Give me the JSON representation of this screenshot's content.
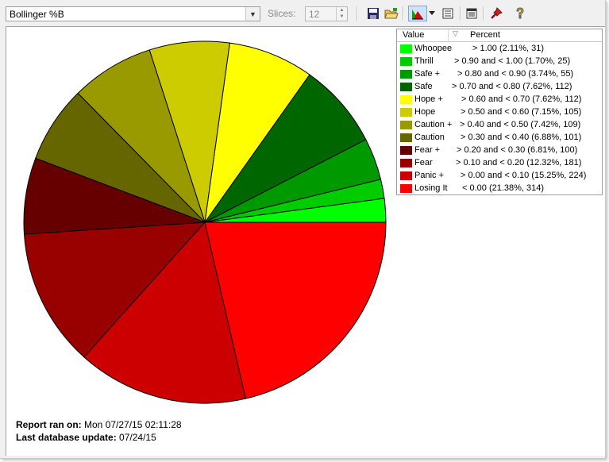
{
  "toolbar": {
    "indicator_select": "Bollinger %B",
    "slices_label": "Slices:",
    "slices_value": "12",
    "icons": [
      "save-icon",
      "open-folder-icon",
      "pie-chart-icon",
      "dropdown-arrow-icon",
      "list-view-icon",
      "notes-icon",
      "pin-icon",
      "help-icon"
    ]
  },
  "legend": {
    "header_value": "Value",
    "header_percent": "Percent",
    "items": [
      {
        "name": "Whoopee",
        "range": "> 1.00 (2.11%, 31)",
        "color": "#00ff00"
      },
      {
        "name": "Thrill",
        "range": "> 0.90 and < 1.00 (1.70%, 25)",
        "color": "#00cc00"
      },
      {
        "name": "Safe +",
        "range": "> 0.80 and < 0.90 (3.74%, 55)",
        "color": "#009900"
      },
      {
        "name": "Safe",
        "range": "> 0.70 and < 0.80 (7.62%, 112)",
        "color": "#006600"
      },
      {
        "name": "Hope +",
        "range": "> 0.60 and < 0.70 (7.62%, 112)",
        "color": "#ffff00"
      },
      {
        "name": "Hope",
        "range": "> 0.50 and < 0.60 (7.15%, 105)",
        "color": "#cccc00"
      },
      {
        "name": "Caution +",
        "range": "> 0.40 and < 0.50 (7.42%, 109)",
        "color": "#999900"
      },
      {
        "name": "Caution",
        "range": "> 0.30 and < 0.40 (6.88%, 101)",
        "color": "#666600"
      },
      {
        "name": "Fear +",
        "range": "> 0.20 and < 0.30 (6.81%, 100)",
        "color": "#660000"
      },
      {
        "name": "Fear",
        "range": "> 0.10 and < 0.20 (12.32%, 181)",
        "color": "#990000"
      },
      {
        "name": "Panic +",
        "range": "> 0.00 and < 0.10 (15.25%, 224)",
        "color": "#cc0000"
      },
      {
        "name": "Losing It",
        "range": "< 0.00 (21.38%, 314)",
        "color": "#ff0000"
      }
    ]
  },
  "footer": {
    "report_label": "Report ran on:",
    "report_value": "Mon 07/27/15 02:11:28",
    "update_label": "Last database update:",
    "update_value": "07/24/15"
  },
  "chart_data": {
    "type": "pie",
    "categories": [
      "Whoopee",
      "Thrill",
      "Safe +",
      "Safe",
      "Hope +",
      "Hope",
      "Caution +",
      "Caution",
      "Fear +",
      "Fear",
      "Panic +",
      "Losing It"
    ],
    "values": [
      31,
      25,
      55,
      112,
      112,
      105,
      109,
      101,
      100,
      181,
      224,
      314
    ],
    "percents": [
      2.11,
      1.7,
      3.74,
      7.62,
      7.62,
      7.15,
      7.42,
      6.88,
      6.81,
      12.32,
      15.25,
      21.38
    ],
    "colors": [
      "#00ff00",
      "#00cc00",
      "#009900",
      "#006600",
      "#ffff00",
      "#cccc00",
      "#999900",
      "#666600",
      "#660000",
      "#990000",
      "#cc0000",
      "#ff0000"
    ],
    "direction": "counterclockwise from 3 o'clock"
  }
}
